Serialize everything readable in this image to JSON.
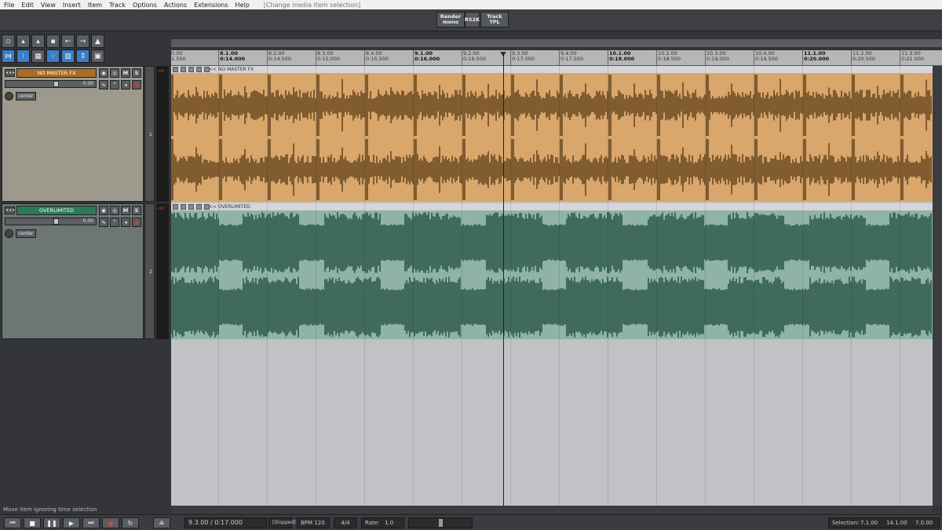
{
  "menu": [
    "File",
    "Edit",
    "View",
    "Insert",
    "Item",
    "Track",
    "Options",
    "Actions",
    "Extensions",
    "Help"
  ],
  "menu_note": "[Change media item selection]",
  "top_buttons": [
    "Render mono",
    "RS2K",
    "Track TPL"
  ],
  "tracks": [
    {
      "name": "NO MASTER FX",
      "item_name": "<< NO MASTER FX",
      "volume": "0.00",
      "pan": "center",
      "number": "1",
      "meter": "-inf",
      "color": "#d9a66b",
      "wave": "#5a3c17",
      "btn_m": "M",
      "btn_s": "S"
    },
    {
      "name": "OVERLIMITED",
      "item_name": "<< OVERLIMITED",
      "volume": "0.00",
      "pan": "center",
      "number": "2",
      "meter": "-inf",
      "color": "#8fb3a5",
      "wave": "#1f4d3d",
      "btn_m": "M",
      "btn_s": "S"
    }
  ],
  "ruler": [
    {
      "bar": "0.00",
      "time": "1.500",
      "major": false
    },
    {
      "bar": "8.1.00",
      "time": "0:14.000",
      "major": true
    },
    {
      "bar": "8.2.00",
      "time": "0:14.500",
      "major": false
    },
    {
      "bar": "8.3.00",
      "time": "0:15.000",
      "major": false
    },
    {
      "bar": "8.4.00",
      "time": "0:15.500",
      "major": false
    },
    {
      "bar": "9.1.00",
      "time": "0:16.000",
      "major": true
    },
    {
      "bar": "9.2.00",
      "time": "0:16.500",
      "major": false
    },
    {
      "bar": "9.3.00",
      "time": "0:17.000",
      "major": false
    },
    {
      "bar": "9.4.00",
      "time": "0:17.500",
      "major": false
    },
    {
      "bar": "10.1.00",
      "time": "0:18.000",
      "major": true
    },
    {
      "bar": "10.2.00",
      "time": "0:18.500",
      "major": false
    },
    {
      "bar": "10.3.00",
      "time": "0:19.000",
      "major": false
    },
    {
      "bar": "10.4.00",
      "time": "0:19.500",
      "major": false
    },
    {
      "bar": "11.1.00",
      "time": "0:20.000",
      "major": true
    },
    {
      "bar": "11.2.00",
      "time": "0:20.500",
      "major": false
    },
    {
      "bar": "11.3.00",
      "time": "0:21.000",
      "major": false
    }
  ],
  "status_message": "Move item ignoring time selection",
  "transport": {
    "position": "9.3.00 / 0:17.000",
    "state": "[Stopped]",
    "bpm_label": "BPM",
    "bpm": "120",
    "time_sig": "4/4",
    "rate_label": "Rate:",
    "rate": "1.0",
    "selection_label": "Selection:",
    "sel_start": "7.1.00",
    "sel_end": "14.1.00",
    "sel_len": "7.0.00"
  }
}
